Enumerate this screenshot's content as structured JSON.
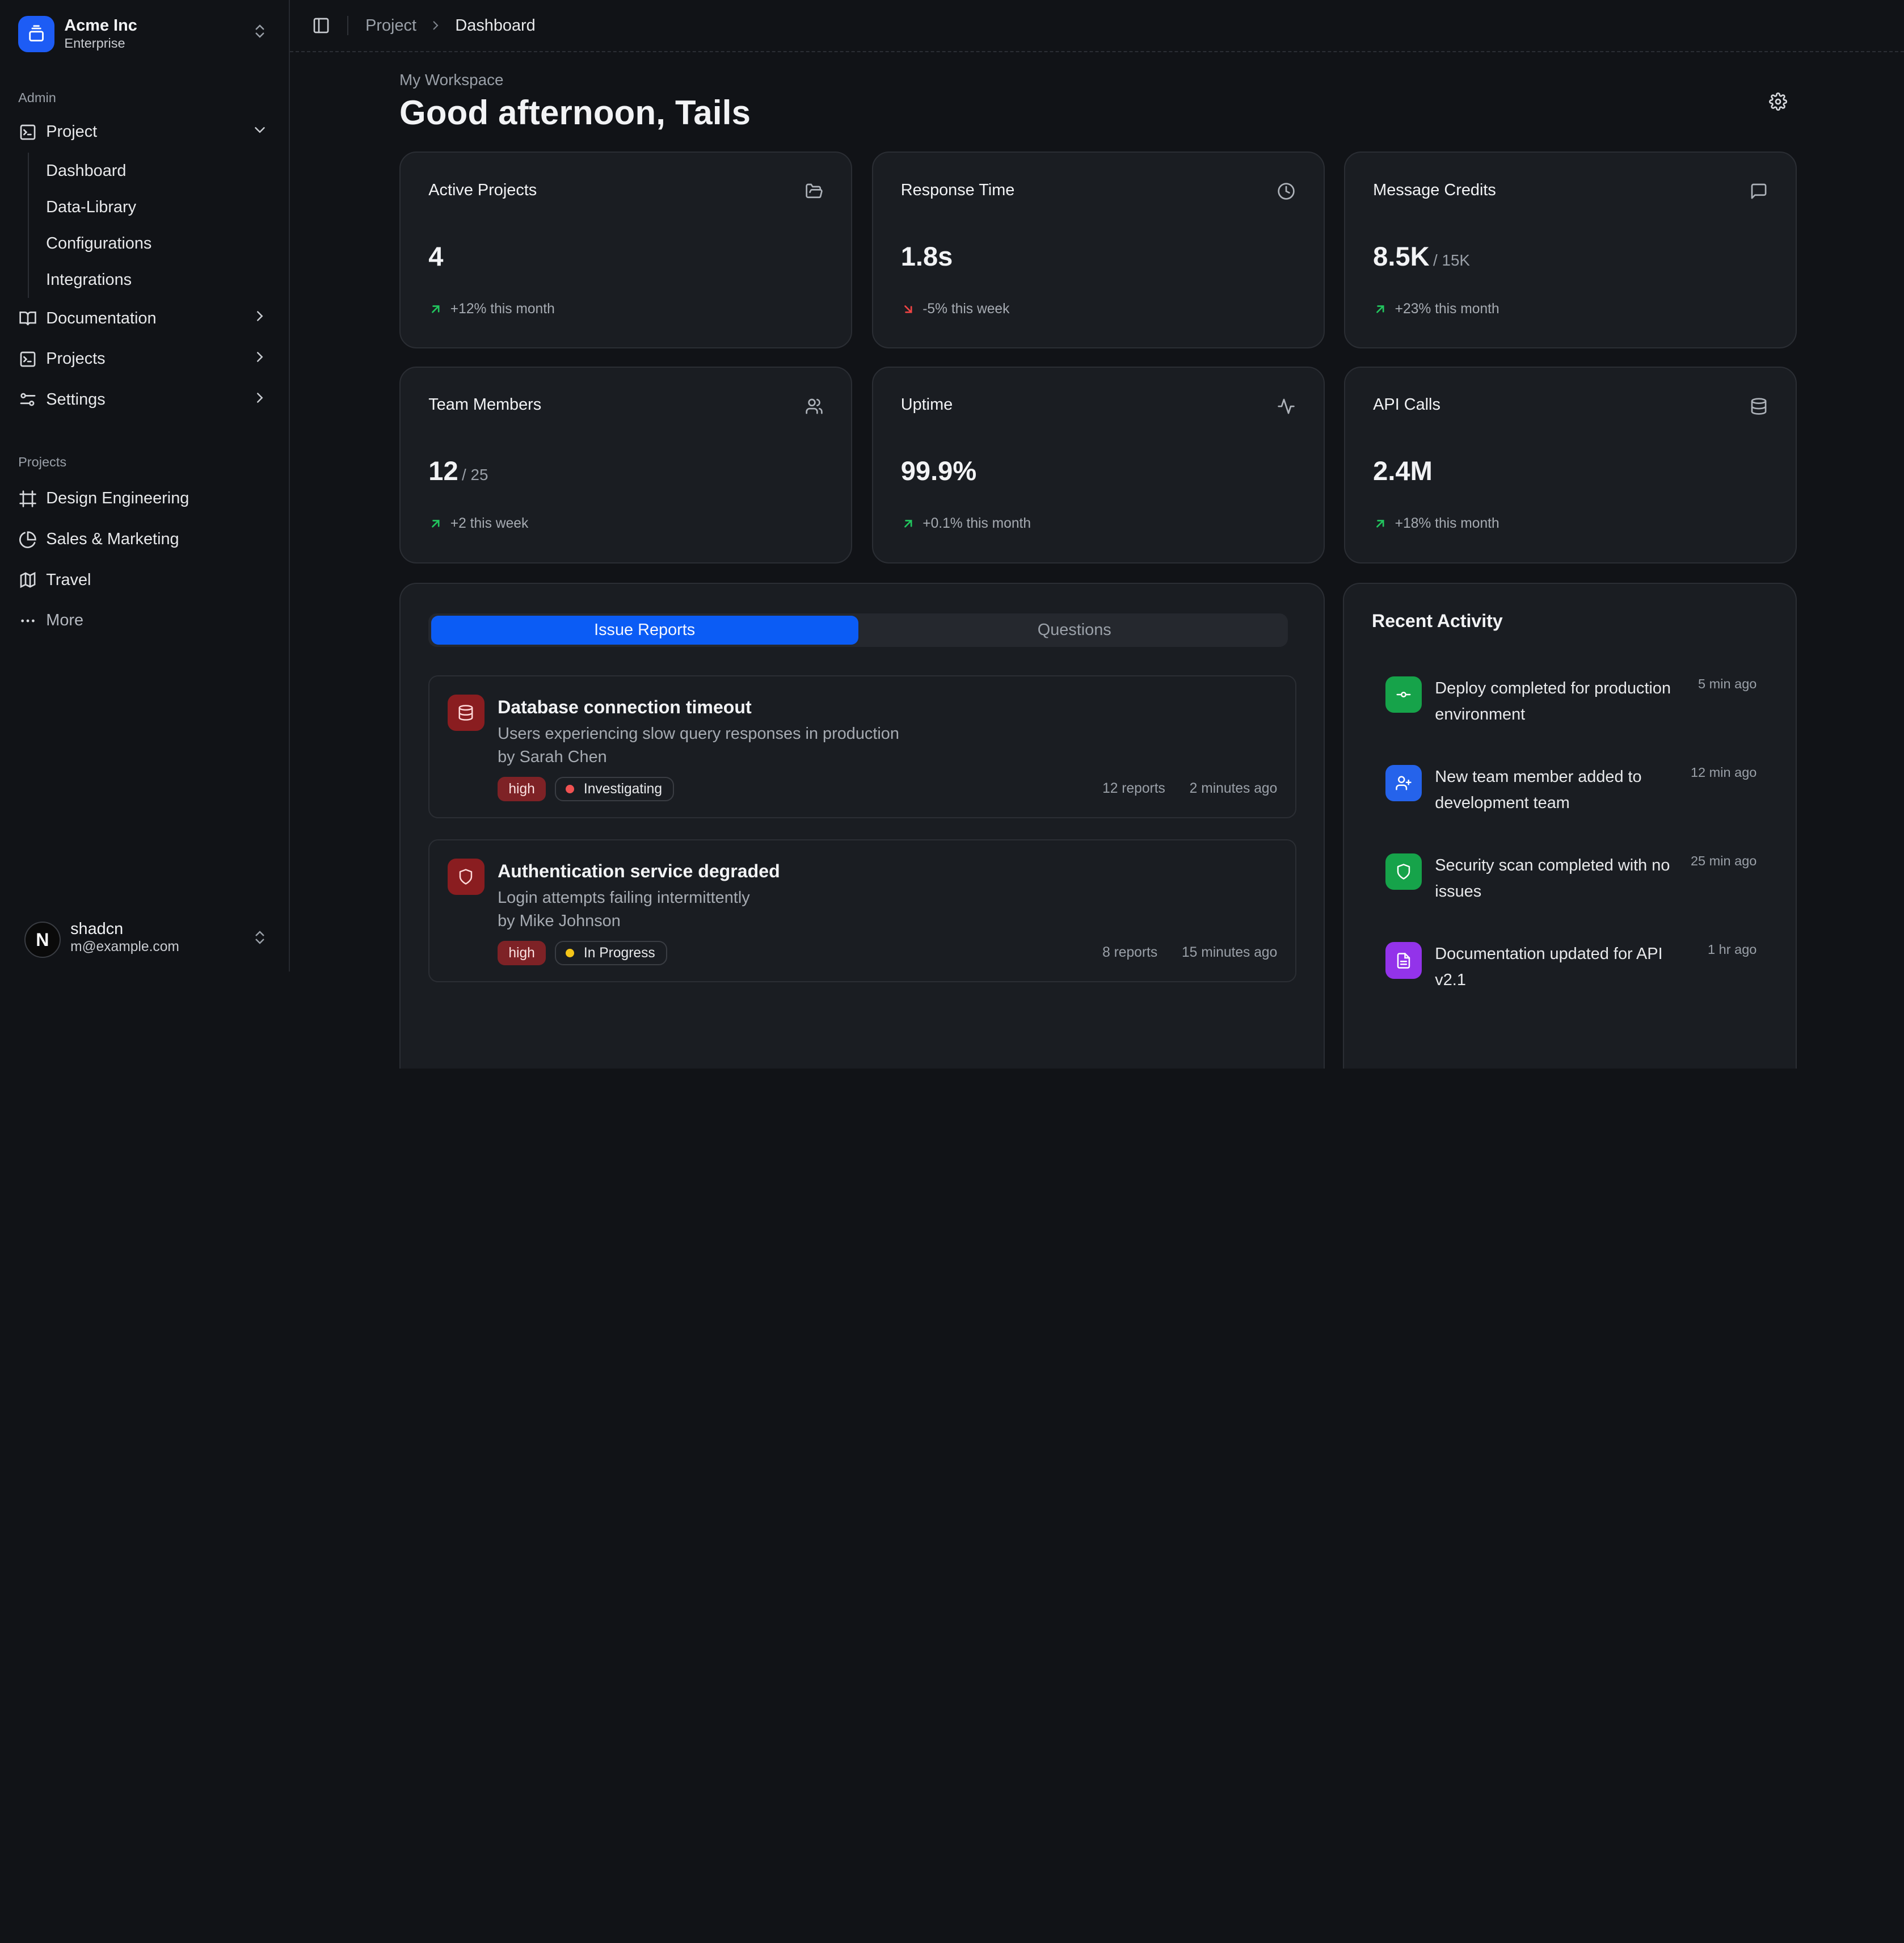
{
  "team": {
    "name": "Acme Inc",
    "plan": "Enterprise"
  },
  "sidebar": {
    "admin_label": "Admin",
    "project": {
      "label": "Project",
      "sub": [
        "Dashboard",
        "Data-Library",
        "Configurations",
        "Integrations"
      ]
    },
    "items": [
      {
        "label": "Documentation",
        "icon": "book-icon"
      },
      {
        "label": "Projects",
        "icon": "terminal-icon"
      },
      {
        "label": "Settings",
        "icon": "sliders-icon"
      }
    ],
    "projects_label": "Projects",
    "projects": [
      {
        "label": "Design Engineering",
        "icon": "frame-icon"
      },
      {
        "label": "Sales & Marketing",
        "icon": "pie-chart-icon"
      },
      {
        "label": "Travel",
        "icon": "map-icon"
      }
    ],
    "more_label": "More"
  },
  "user": {
    "initial": "N",
    "name": "shadcn",
    "email": "m@example.com"
  },
  "breadcrumb": {
    "parent": "Project",
    "current": "Dashboard"
  },
  "header": {
    "workspace": "My Workspace",
    "greeting": "Good afternoon, Tails"
  },
  "stats": [
    {
      "title": "Active Projects",
      "icon": "folder-open-icon",
      "value": "4",
      "of": "",
      "delta": "+12% this month",
      "trend": "up"
    },
    {
      "title": "Response Time",
      "icon": "clock-icon",
      "value": "1.8s",
      "of": "",
      "delta": "-5% this week",
      "trend": "down"
    },
    {
      "title": "Message Credits",
      "icon": "message-icon",
      "value": "8.5K",
      "of": "/ 15K",
      "delta": "+23% this month",
      "trend": "up"
    },
    {
      "title": "Team Members",
      "icon": "users-icon",
      "value": "12",
      "of": "/ 25",
      "delta": "+2 this week",
      "trend": "up"
    },
    {
      "title": "Uptime",
      "icon": "activity-icon",
      "value": "99.9%",
      "of": "",
      "delta": "+0.1% this month",
      "trend": "up"
    },
    {
      "title": "API Calls",
      "icon": "database-icon",
      "value": "2.4M",
      "of": "",
      "delta": "+18% this month",
      "trend": "up"
    }
  ],
  "tabs": {
    "issues": "Issue Reports",
    "questions": "Questions"
  },
  "issues": [
    {
      "title": "Database connection timeout",
      "description": "Users experiencing slow query responses in production",
      "author": "by Sarah Chen",
      "severity": "high",
      "status": "Investigating",
      "status_color": "#f05252",
      "reports": "12 reports",
      "time": "2 minutes ago",
      "icon": "database-icon"
    },
    {
      "title": "Authentication service degraded",
      "description": "Login attempts failing intermittently",
      "author": "by Mike Johnson",
      "severity": "high",
      "status": "In Progress",
      "status_color": "#f5c518",
      "reports": "8 reports",
      "time": "15 minutes ago",
      "icon": "shield-icon"
    }
  ],
  "activity": {
    "title": "Recent Activity",
    "items": [
      {
        "text": "Deploy completed for production environment",
        "time": "5 min ago",
        "color": "#16a34a",
        "icon": "git-commit-icon"
      },
      {
        "text": "New team member added to development team",
        "time": "12 min ago",
        "color": "#2563eb",
        "icon": "user-plus-icon"
      },
      {
        "text": "Security scan completed with no issues",
        "time": "25 min ago",
        "color": "#16a34a",
        "icon": "shield-icon"
      },
      {
        "text": "Documentation updated for API v2.1",
        "time": "1 hr ago",
        "color": "#9333ea",
        "icon": "file-text-icon"
      }
    ]
  }
}
